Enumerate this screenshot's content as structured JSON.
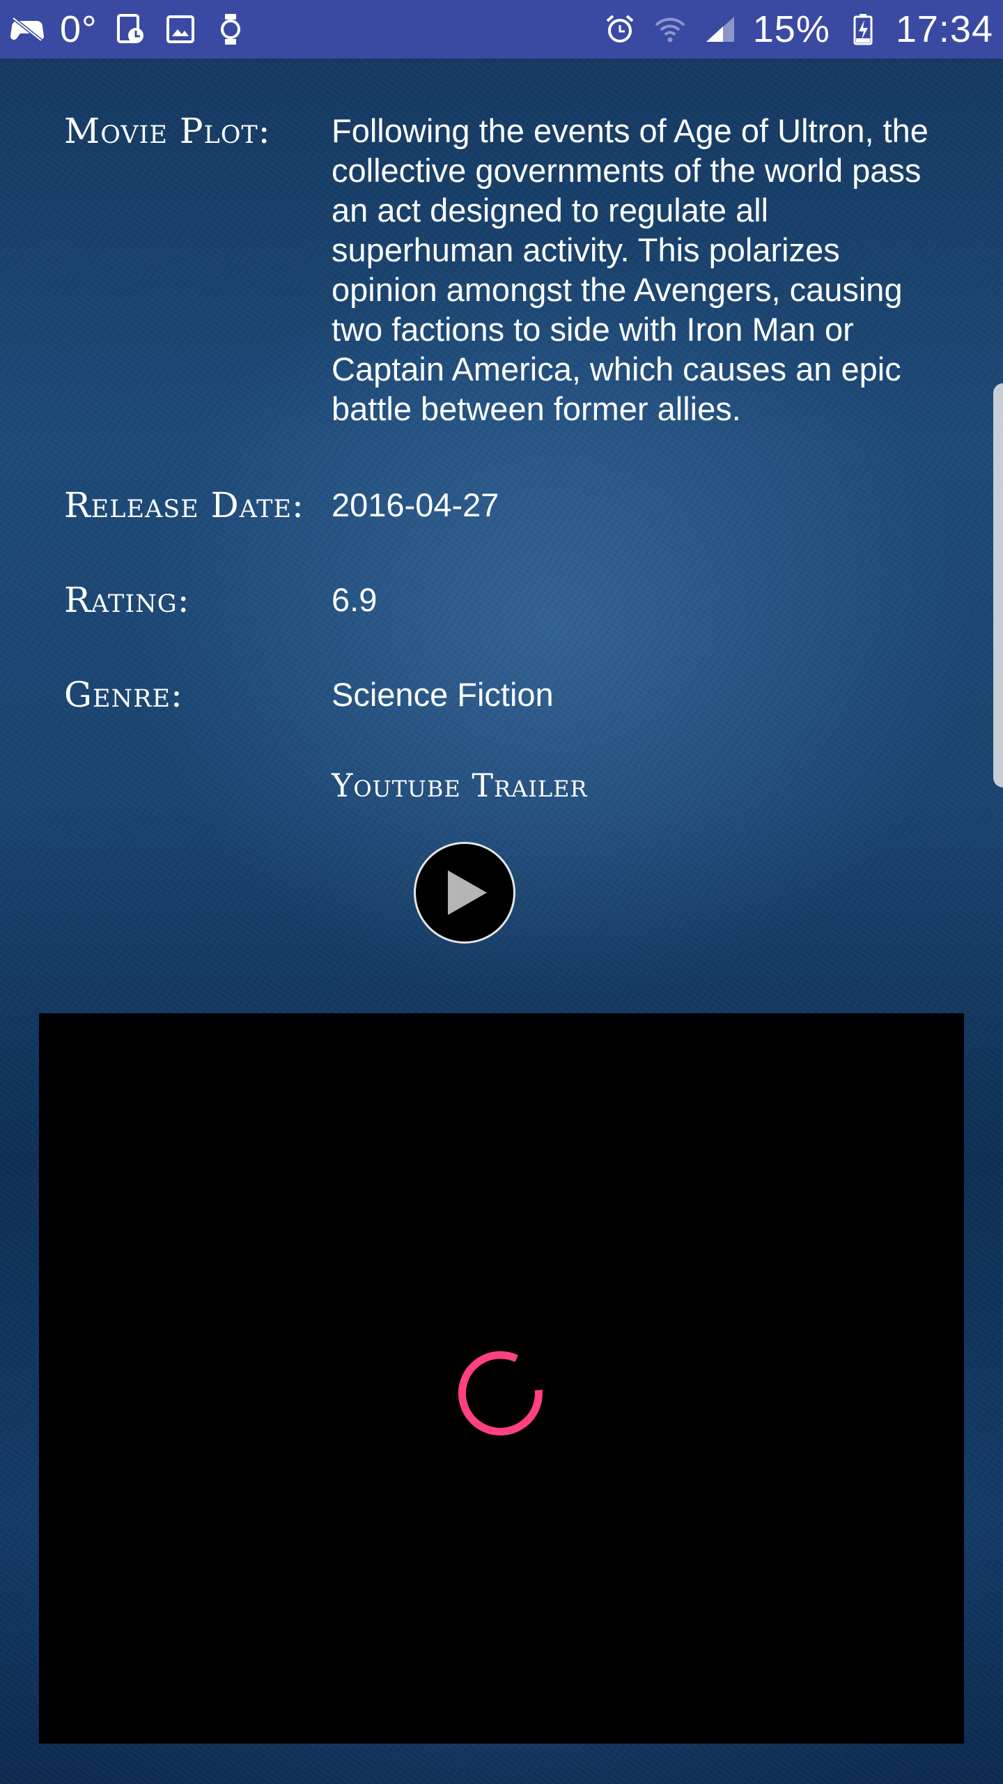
{
  "status_bar": {
    "temperature": "0°",
    "battery_percent": "15%",
    "time": "17:34",
    "icons_left": [
      "game-controller-icon",
      "doc-clock-icon",
      "image-icon",
      "watch-icon"
    ],
    "icons_right": [
      "alarm-icon",
      "wifi-icon",
      "signal-icon",
      "battery-charging-icon"
    ],
    "background_color": "#3a4aa3"
  },
  "details": {
    "plot": {
      "label": "Movie Plot:",
      "value": "Following the events of Age of Ultron, the collective governments of the world pass an act designed to regulate all superhuman activity. This polarizes opinion amongst the Avengers, causing two factions to side with Iron Man or Captain America, which causes an epic battle between former allies."
    },
    "release_date": {
      "label": "Release Date:",
      "value": "2016-04-27"
    },
    "rating": {
      "label": "Rating:",
      "value": "6.9"
    },
    "genre": {
      "label": "Genre:",
      "value": "Science Fiction"
    },
    "trailer": {
      "label": "Youtube Trailer",
      "play_icon": "play-icon"
    }
  },
  "video_player": {
    "state": "loading",
    "spinner_color": "#ff4081"
  }
}
